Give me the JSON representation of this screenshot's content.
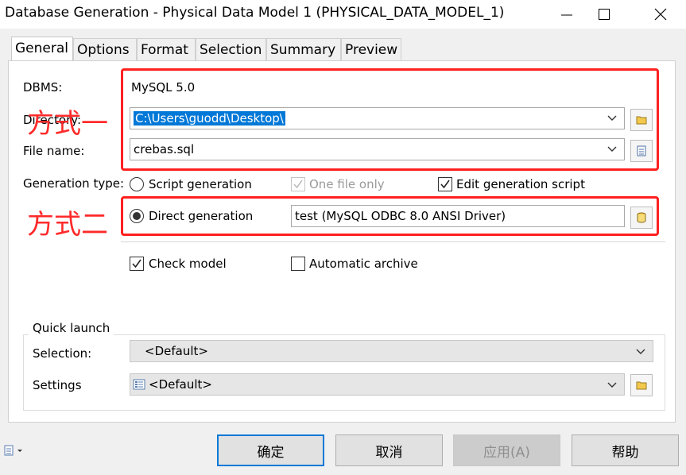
{
  "window": {
    "title": "Database Generation - Physical Data Model 1 (PHYSICAL_DATA_MODEL_1)"
  },
  "tabs": [
    {
      "label": "General",
      "active": true
    },
    {
      "label": "Options"
    },
    {
      "label": "Format"
    },
    {
      "label": "Selection"
    },
    {
      "label": "Summary"
    },
    {
      "label": "Preview"
    }
  ],
  "general": {
    "dbms_label": "DBMS:",
    "dbms_value": "MySQL 5.0",
    "directory_label": "Directory:",
    "directory_value": "C:\\Users\\guodd\\Desktop\\",
    "filename_label": "File name:",
    "filename_value": "crebas.sql",
    "generation_type_label": "Generation type:",
    "script_generation_label": "Script generation",
    "one_file_only_label": "One file only",
    "edit_generation_script_label": "Edit generation script",
    "direct_generation_label": "Direct generation",
    "data_source_value": "test (MySQL ODBC 8.0 ANSI Driver)",
    "check_model_label": "Check model",
    "automatic_archive_label": "Automatic archive"
  },
  "state": {
    "generation_type": "direct",
    "one_file_only": true,
    "one_file_only_disabled": true,
    "edit_generation_script": true,
    "check_model": true,
    "automatic_archive": false
  },
  "annotations": {
    "method1": "方式一",
    "method2": "方式二",
    "color": "#ff2020"
  },
  "quick_launch": {
    "title": "Quick launch",
    "selection_label": "Selection:",
    "selection_value": "<Default>",
    "settings_label": "Settings",
    "settings_value": "<Default>"
  },
  "buttons": {
    "ok": "确定",
    "cancel": "取消",
    "apply": "应用(A)",
    "help": "帮助"
  },
  "icons": {
    "close": "close-icon",
    "maximize": "maximize-icon",
    "minimize": "minimize-icon",
    "folder": "folder-icon",
    "file": "file-icon",
    "datasource": "database-icon",
    "settings_item": "settings-list-icon",
    "menu": "menu-icon"
  }
}
